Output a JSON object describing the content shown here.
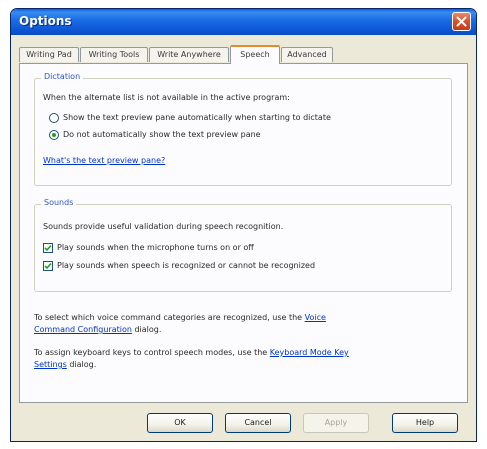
{
  "window": {
    "title": "Options"
  },
  "tabs": [
    {
      "label": "Writing Pad",
      "active": false
    },
    {
      "label": "Writing Tools",
      "active": false
    },
    {
      "label": "Write Anywhere",
      "active": false
    },
    {
      "label": "Speech",
      "active": true
    },
    {
      "label": "Advanced",
      "active": false
    }
  ],
  "dictation": {
    "group_label": "Dictation",
    "intro": "When the alternate list is not available in the active program:",
    "option_show": "Show the text preview pane automatically when starting to dictate",
    "option_show_checked": false,
    "option_donot": "Do not automatically show the text preview pane",
    "option_donot_checked": true,
    "link": "What's the text preview pane?"
  },
  "sounds": {
    "group_label": "Sounds",
    "intro": "Sounds provide useful validation during speech recognition.",
    "check_mic": "Play sounds when the microphone turns on or off",
    "check_mic_checked": true,
    "check_recognized": "Play sounds when speech is recognized or cannot be recognized",
    "check_recognized_checked": true
  },
  "voice_command": {
    "text_before": "To select which voice command categories are recognized, use the ",
    "link_part1": "Voice",
    "link_part2": "Command Configuration",
    "text_after": " dialog."
  },
  "keyboard_mode": {
    "text_before": "To assign keyboard keys to control speech modes, use the ",
    "link_part1": "Keyboard Mode Key",
    "link_part2": "Settings",
    "text_after": " dialog."
  },
  "buttons": {
    "ok": "OK",
    "cancel": "Cancel",
    "apply": "Apply",
    "help": "Help"
  },
  "colors": {
    "titlebar": "#0a5ed8",
    "group_label": "#2d56c8",
    "link": "#0033cc",
    "active_tab_accent": "#e68b2c"
  },
  "icons": {
    "close": "close-x-icon",
    "check": "checkmark-icon"
  }
}
